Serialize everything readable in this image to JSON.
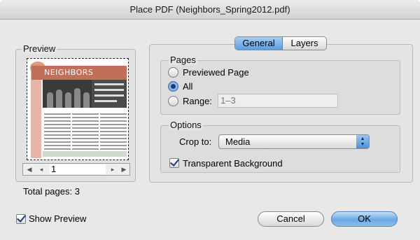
{
  "window": {
    "title": "Place PDF (Neighbors_Spring2012.pdf)"
  },
  "preview": {
    "legend": "Preview",
    "thumbnail": {
      "masthead": "NEIGHBORS"
    },
    "pager": {
      "current_page": "1",
      "first_icon": "first-page-icon",
      "prev_icon": "prev-page-icon",
      "next_icon": "next-page-icon",
      "last_icon": "last-page-icon"
    },
    "total_pages": "Total pages: 3",
    "show_preview_label": "Show Preview",
    "show_preview_checked": true
  },
  "tabs": {
    "general": "General",
    "layers": "Layers",
    "active": "general"
  },
  "pages": {
    "legend": "Pages",
    "options": [
      {
        "label": "Previewed Page",
        "selected": false
      },
      {
        "label": "All",
        "selected": true
      },
      {
        "label": "Range:",
        "selected": false
      }
    ],
    "range_value": "1–3"
  },
  "options": {
    "legend": "Options",
    "crop_label": "Crop to:",
    "crop_value": "Media",
    "transparent_label": "Transparent Background",
    "transparent_checked": true
  },
  "buttons": {
    "cancel": "Cancel",
    "ok": "OK"
  },
  "colors": {
    "accent_blue": "#5e9cde",
    "masthead": "#c26f5a"
  }
}
